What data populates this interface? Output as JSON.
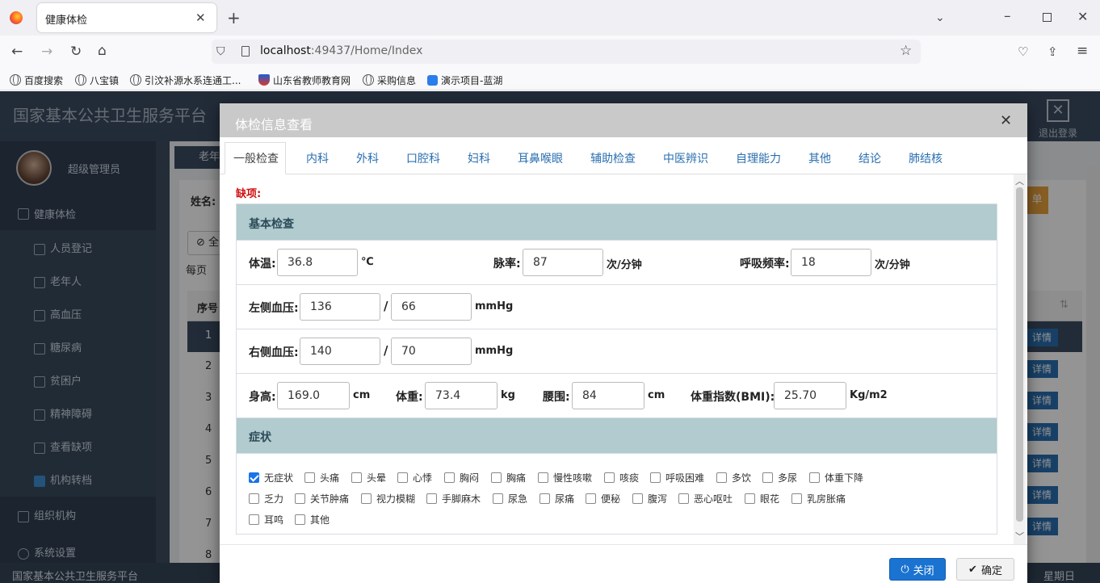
{
  "browser": {
    "tab_title": "健康体检",
    "url_host": "localhost",
    "url_path": ":49437/Home/Index",
    "bookmarks": [
      "百度搜索",
      "八宝镇",
      "引汶补源水系连通工...",
      "山东省教师教育网",
      "采购信息",
      "演示项目-蓝湖"
    ]
  },
  "app": {
    "title": "国家基本公共卫生服务平台",
    "logout": "退出登录",
    "user": "超级管理员",
    "footer": "国家基本公共卫生服务平台",
    "footer_right": "星期日",
    "content_tab": "老年人"
  },
  "sidebar": {
    "group1": "健康体检",
    "items": [
      "人员登记",
      "老年人",
      "高血压",
      "糖尿病",
      "贫困户",
      "精神障碍",
      "查看缺项",
      "机构转档"
    ],
    "group2": "组织机构",
    "group3": "系统设置"
  },
  "background": {
    "name_label": "姓名:",
    "all_btn": "全",
    "per_page": "每页",
    "col_seq": "序号",
    "rows": [
      "1",
      "2",
      "3",
      "4",
      "5",
      "6",
      "7",
      "8"
    ],
    "detail": "详情",
    "orange_btn": "单"
  },
  "modal": {
    "title": "体检信息查看",
    "tabs": [
      "一般检查",
      "内科",
      "外科",
      "口腔科",
      "妇科",
      "耳鼻喉眼",
      "辅助检查",
      "中医辨识",
      "自理能力",
      "其他",
      "结论",
      "肺结核"
    ],
    "missing_label": "缺项:",
    "section_basic": "基本检查",
    "temp_label": "体温:",
    "temp": "36.8",
    "temp_unit": "℃",
    "pulse_label": "脉率:",
    "pulse": "87",
    "pulse_unit": "次/分钟",
    "resp_label": "呼吸频率:",
    "resp": "18",
    "resp_unit": "次/分钟",
    "lbp_label": "左侧血压:",
    "lbp_sys": "136",
    "lbp_dia": "66",
    "rbp_label": "右侧血压:",
    "rbp_sys": "140",
    "rbp_dia": "70",
    "bp_unit": "mmHg",
    "slash": "/",
    "height_label": "身高:",
    "height": "169.0",
    "height_unit": "cm",
    "weight_label": "体重:",
    "weight": "73.4",
    "weight_unit": "kg",
    "waist_label": "腰围:",
    "waist": "84",
    "waist_unit": "cm",
    "bmi_label": "体重指数(BMI):",
    "bmi": "25.70",
    "bmi_unit": "Kg/m2",
    "section_symptoms": "症状",
    "symptoms": [
      {
        "label": "无症状",
        "checked": true
      },
      {
        "label": "头痛",
        "checked": false
      },
      {
        "label": "头晕",
        "checked": false
      },
      {
        "label": "心悸",
        "checked": false
      },
      {
        "label": "胸闷",
        "checked": false
      },
      {
        "label": "胸痛",
        "checked": false
      },
      {
        "label": "慢性咳嗽",
        "checked": false
      },
      {
        "label": "咳痰",
        "checked": false
      },
      {
        "label": "呼吸困难",
        "checked": false
      },
      {
        "label": "多饮",
        "checked": false
      },
      {
        "label": "多尿",
        "checked": false
      },
      {
        "label": "体重下降",
        "checked": false
      },
      {
        "label": "乏力",
        "checked": false
      },
      {
        "label": "关节肿痛",
        "checked": false
      },
      {
        "label": "视力模糊",
        "checked": false
      },
      {
        "label": "手脚麻木",
        "checked": false
      },
      {
        "label": "尿急",
        "checked": false
      },
      {
        "label": "尿痛",
        "checked": false
      },
      {
        "label": "便秘",
        "checked": false
      },
      {
        "label": "腹泻",
        "checked": false
      },
      {
        "label": "恶心呕吐",
        "checked": false
      },
      {
        "label": "眼花",
        "checked": false
      },
      {
        "label": "乳房胀痛",
        "checked": false
      },
      {
        "label": "耳鸣",
        "checked": false
      },
      {
        "label": "其他",
        "checked": false
      }
    ],
    "close_btn": "关闭",
    "ok_btn": "确定"
  }
}
